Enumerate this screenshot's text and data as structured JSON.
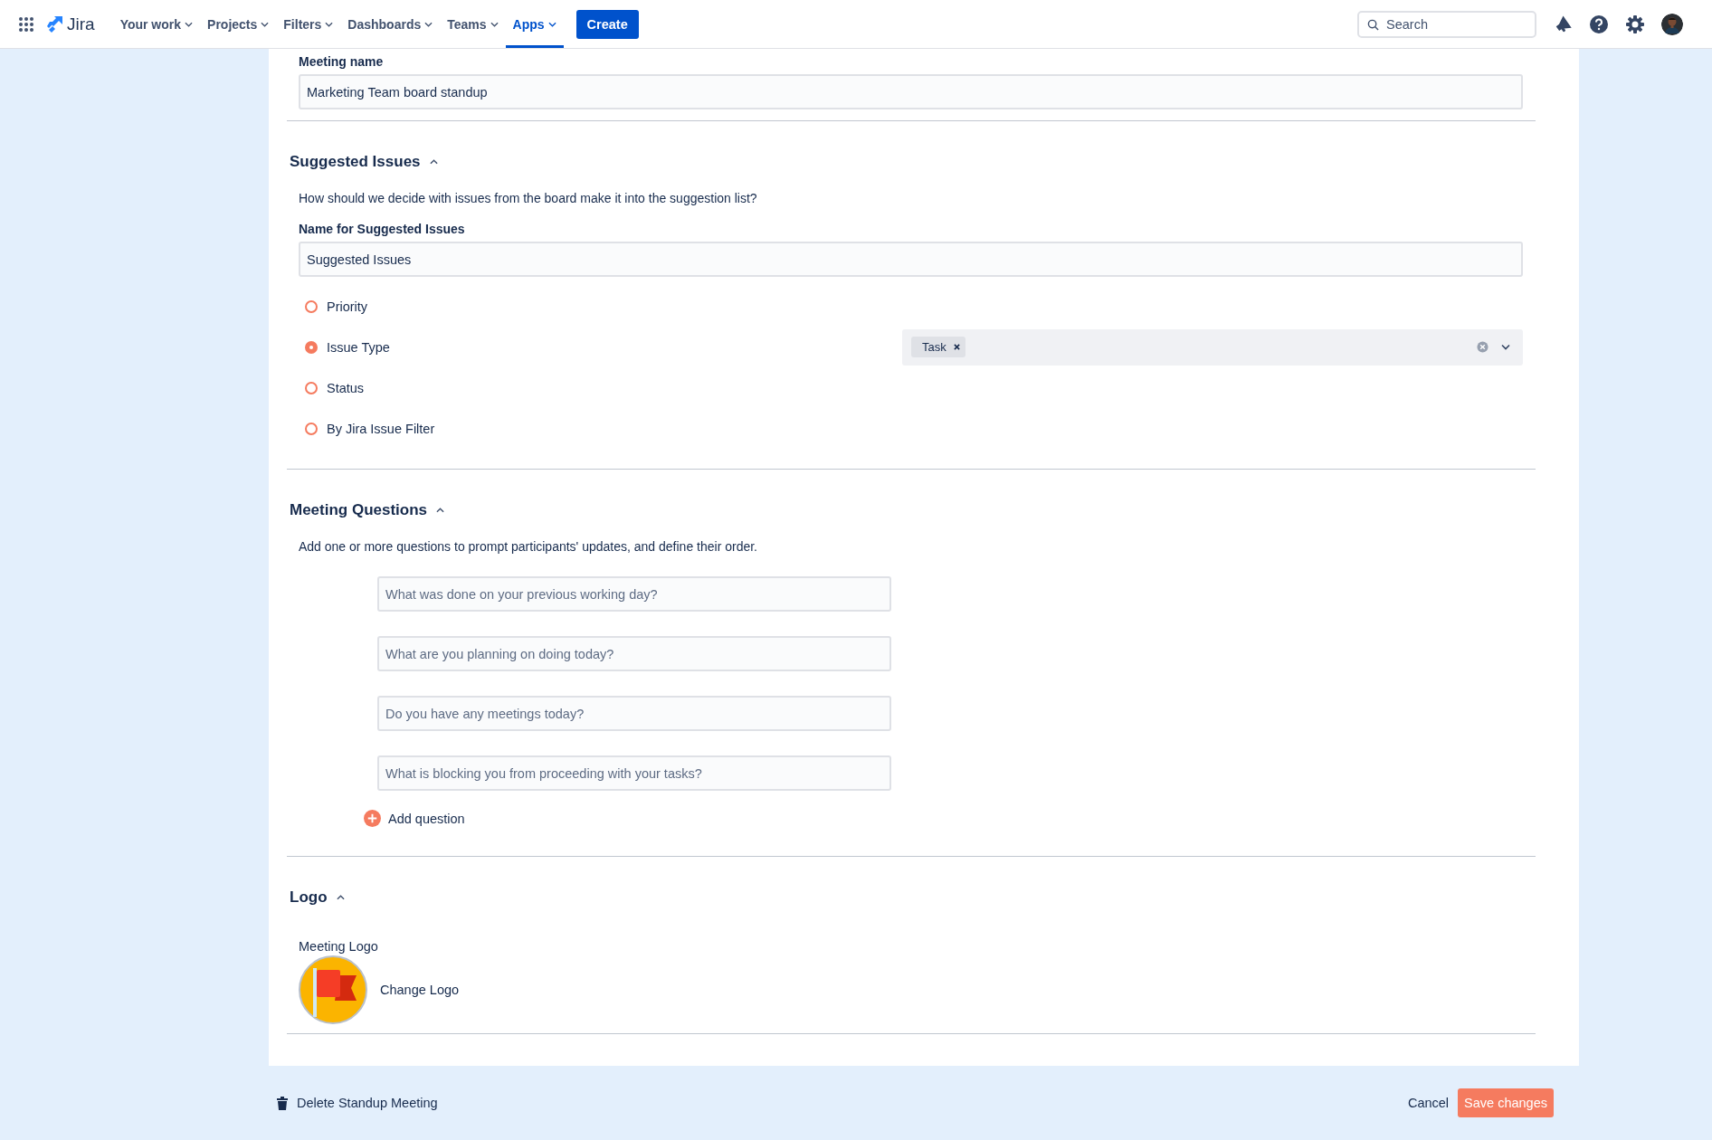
{
  "nav": {
    "logo": "Jira",
    "items": [
      {
        "label": "Your work",
        "selected": false
      },
      {
        "label": "Projects",
        "selected": false
      },
      {
        "label": "Filters",
        "selected": false
      },
      {
        "label": "Dashboards",
        "selected": false
      },
      {
        "label": "Teams",
        "selected": false
      },
      {
        "label": "Apps",
        "selected": true
      }
    ],
    "create": "Create",
    "search": {
      "placeholder": "Search"
    }
  },
  "meeting_name": {
    "label": "Meeting name",
    "value": "Marketing Team board standup"
  },
  "suggested_issues": {
    "title": "Suggested Issues",
    "expanded": true,
    "description": "How should we decide with issues from the board make it into the suggestion list?",
    "name_field": {
      "label": "Name for Suggested Issues",
      "value": "Suggested Issues"
    },
    "options": [
      {
        "label": "Priority",
        "selected": false
      },
      {
        "label": "Issue Type",
        "selected": true,
        "tags": [
          "Task"
        ]
      },
      {
        "label": "Status",
        "selected": false
      },
      {
        "label": "By Jira Issue Filter",
        "selected": false
      }
    ]
  },
  "meeting_questions": {
    "title": "Meeting Questions",
    "expanded": true,
    "description": "Add one or more questions to prompt participants' updates, and define their order.",
    "questions": [
      {
        "placeholder": "What was done on your previous working day?"
      },
      {
        "placeholder": "What are you planning on doing today?"
      },
      {
        "placeholder": "Do you have any meetings today?"
      },
      {
        "placeholder": "What is blocking you from proceeding with your tasks?"
      }
    ],
    "add": "Add question"
  },
  "logo": {
    "title": "Logo",
    "expanded": true,
    "label": "Meeting Logo",
    "change": "Change Logo"
  },
  "footer": {
    "delete": "Delete Standup Meeting",
    "cancel": "Cancel",
    "save": "Save changes"
  }
}
